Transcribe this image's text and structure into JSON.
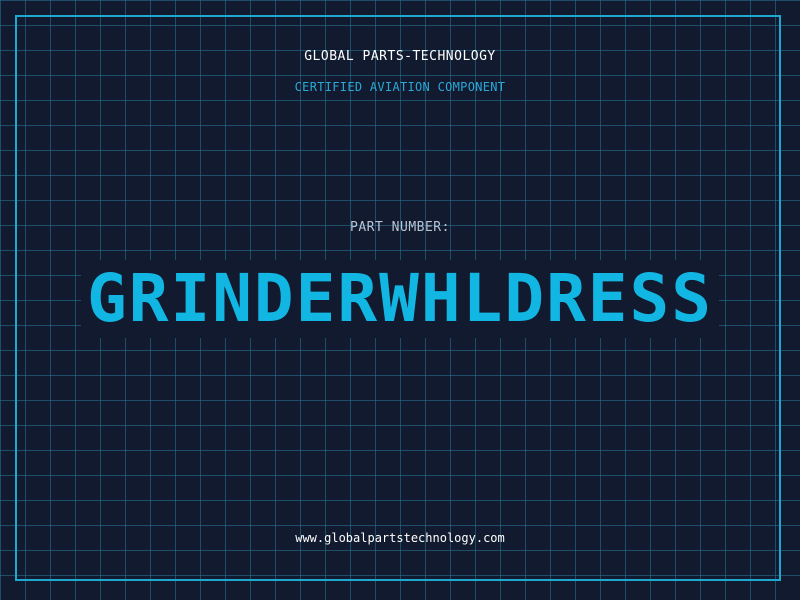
{
  "header": {
    "company": "GLOBAL PARTS-TECHNOLOGY",
    "subtitle": "CERTIFIED AVIATION COMPONENT"
  },
  "part": {
    "label": "PART NUMBER:",
    "number": "GRINDERWHLDRESS"
  },
  "footer": {
    "url": "www.globalpartstechnology.com"
  },
  "colors": {
    "background": "#111a2e",
    "grid": "#28788f",
    "frame": "#1ea7cf",
    "accent": "#12b6e2",
    "label": "#b9c3d3",
    "text": "#ffffff"
  }
}
